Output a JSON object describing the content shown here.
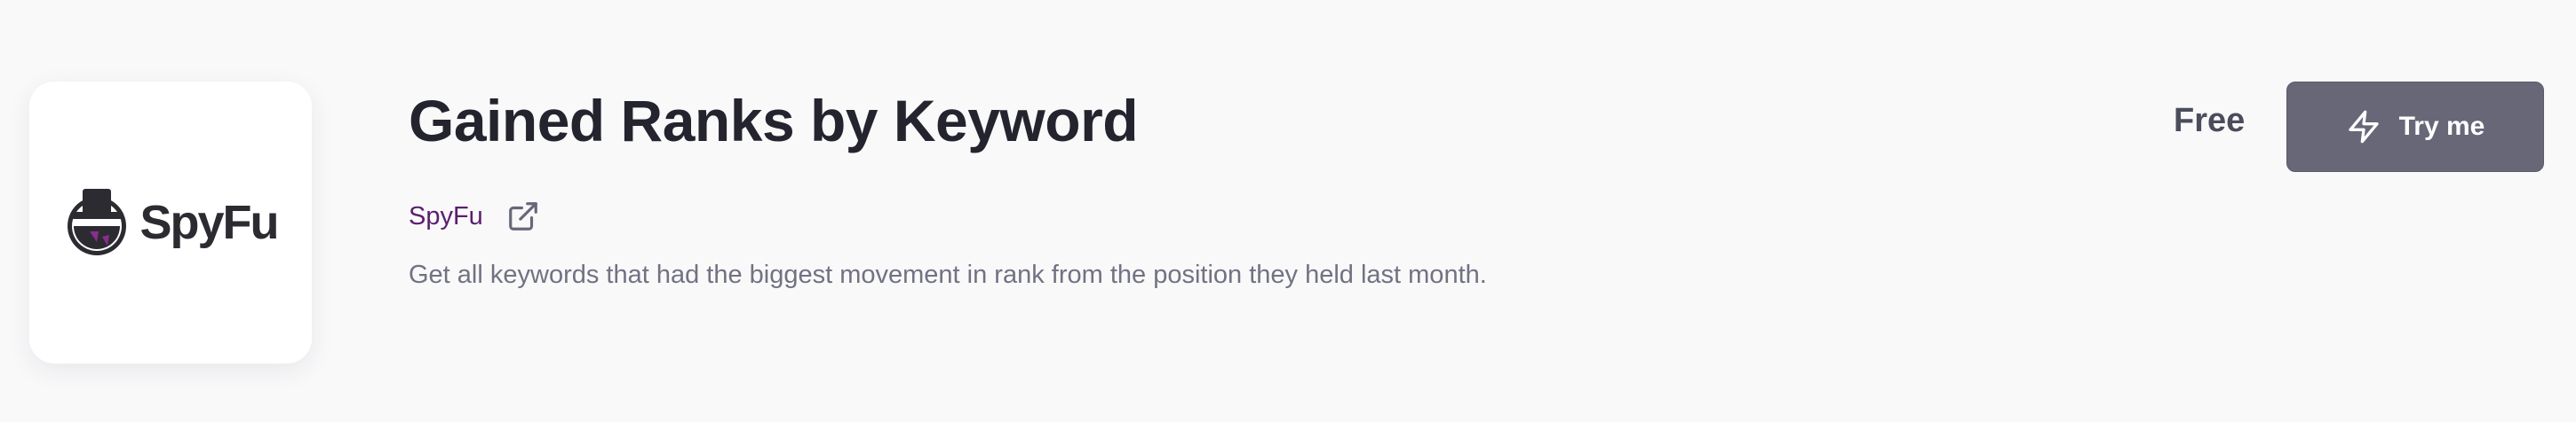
{
  "app": {
    "title": "Gained Ranks by Keyword",
    "logo_text": "SpyFu",
    "logo_icon": "spyfu-spy-icon",
    "provider": {
      "name": "SpyFu",
      "link_icon": "external-link-icon"
    },
    "description": "Get all keywords that had the biggest movement in rank from the position they held last month.",
    "price": "Free",
    "cta": {
      "label": "Try me",
      "icon": "lightning-bolt-icon"
    }
  },
  "colors": {
    "background": "#f9f9fa",
    "title": "#23242e",
    "provider_link": "#5a1f6e",
    "description": "#717282",
    "price": "#4b4d5c",
    "button_bg": "#676778",
    "button_text": "#ffffff",
    "logo_accent": "#8a2d8e"
  }
}
